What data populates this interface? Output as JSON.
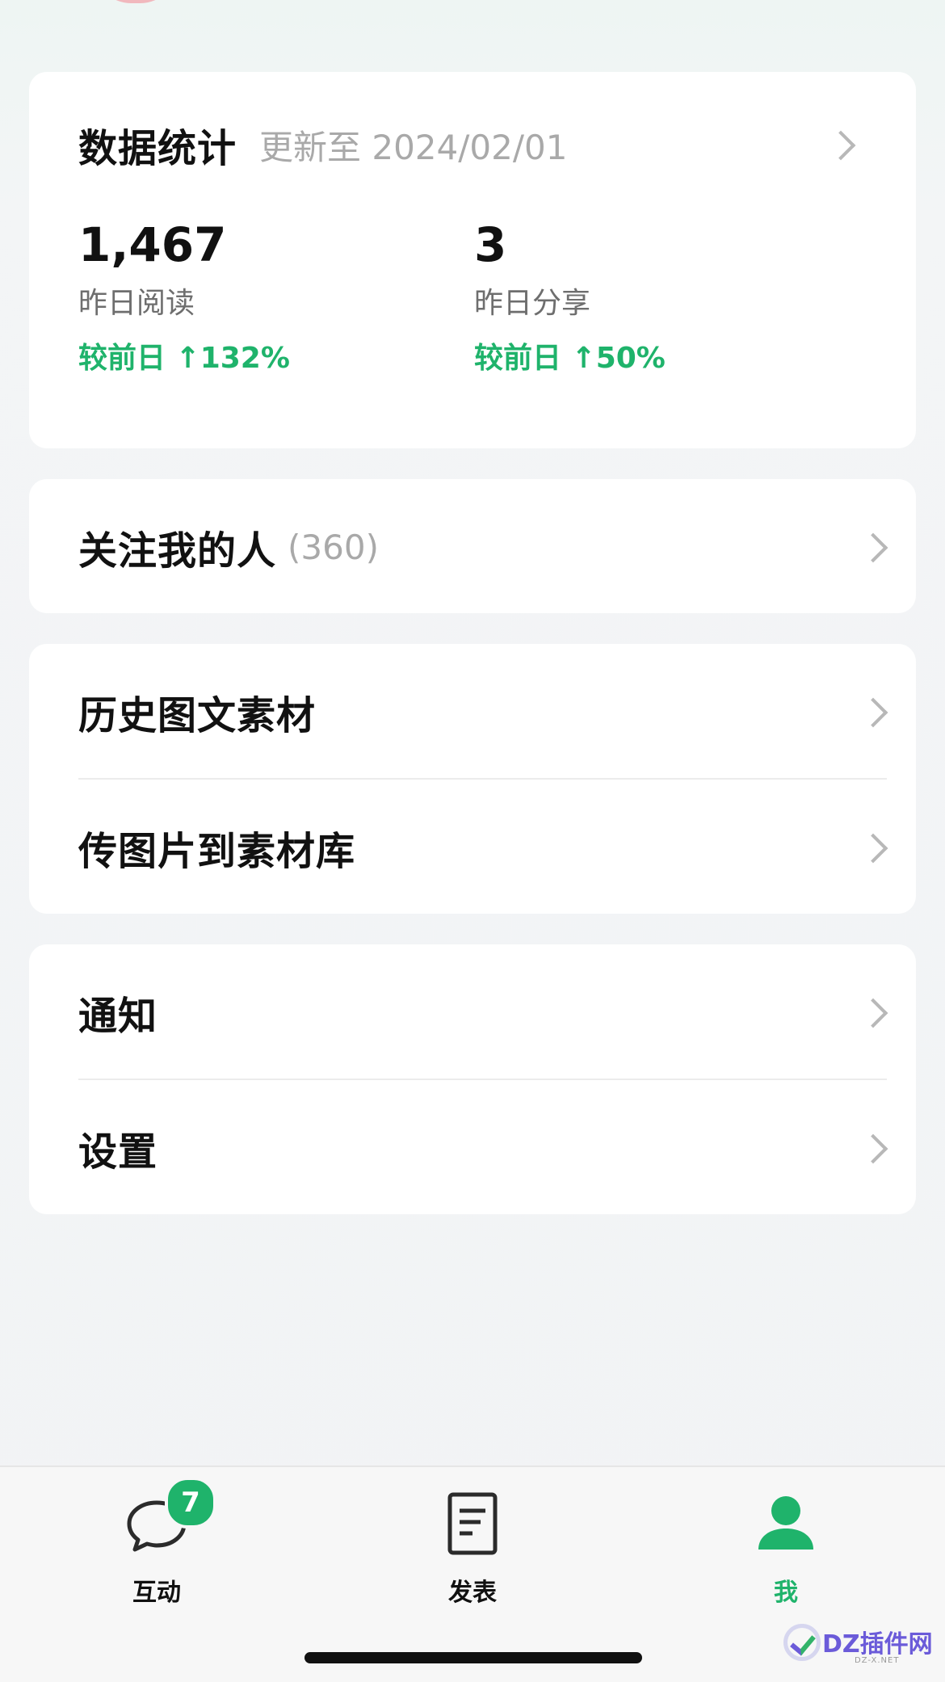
{
  "stats": {
    "title": "数据统计",
    "updated": "更新至 2024/02/01",
    "items": [
      {
        "value": "1,467",
        "label": "昨日阅读",
        "change": "较前日 ↑132%"
      },
      {
        "value": "3",
        "label": "昨日分享",
        "change": "较前日 ↑50%"
      }
    ]
  },
  "followers": {
    "label": "关注我的人",
    "count": "(360)"
  },
  "materials": {
    "items": [
      {
        "label": "历史图文素材"
      },
      {
        "label": "传图片到素材库"
      }
    ]
  },
  "settings": {
    "items": [
      {
        "label": "通知"
      },
      {
        "label": "设置"
      }
    ]
  },
  "tabbar": {
    "tabs": [
      {
        "label": "互动",
        "icon": "chat-bubble-icon",
        "badge": "7"
      },
      {
        "label": "发表",
        "icon": "document-icon"
      },
      {
        "label": "我",
        "icon": "person-icon",
        "active": true
      }
    ]
  },
  "watermark": {
    "text": "DZ插件网",
    "sub": "DZ-X.NET"
  },
  "colors": {
    "accent": "#1fb36b",
    "muted": "#a9a9a9",
    "background": "#f2f3f5"
  }
}
